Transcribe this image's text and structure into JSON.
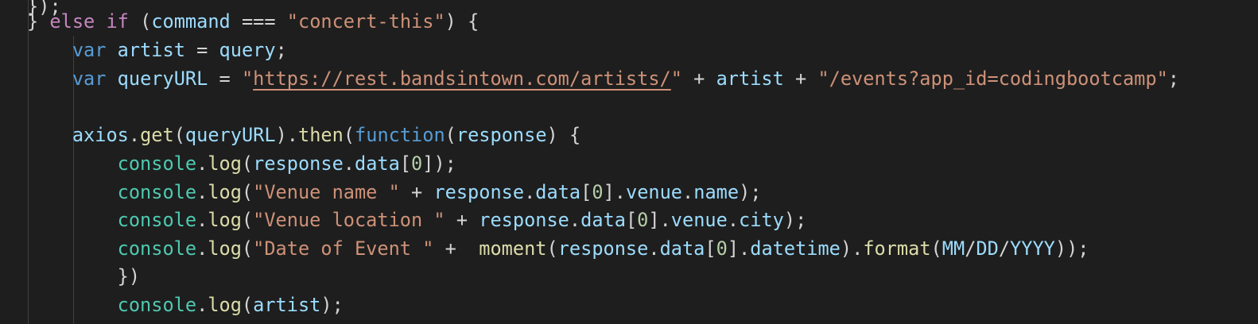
{
  "editor": {
    "language": "javascript",
    "theme_colors": {
      "background": "#1e1e1e",
      "keyword_control": "#c586c0",
      "keyword": "#569cd6",
      "variable": "#9cdcfe",
      "string": "#ce9178",
      "function": "#dcdcaa",
      "class": "#4ec9b0",
      "number": "#b5cea8",
      "default": "#d4d4d4"
    },
    "lines": [
      {
        "tokens": [
          {
            "t": "}",
            "c": "punc"
          },
          {
            "t": ")",
            "c": "punc"
          },
          {
            "t": ";",
            "c": "punc"
          }
        ]
      },
      {
        "tokens": [
          {
            "t": "} ",
            "c": "punc"
          },
          {
            "t": "else",
            "c": "kw-ctrl"
          },
          {
            "t": " ",
            "c": "punc"
          },
          {
            "t": "if",
            "c": "kw-ctrl"
          },
          {
            "t": " (",
            "c": "punc"
          },
          {
            "t": "command",
            "c": "var"
          },
          {
            "t": " === ",
            "c": "punc"
          },
          {
            "t": "\"concert-this\"",
            "c": "str"
          },
          {
            "t": ") {",
            "c": "punc"
          }
        ]
      },
      {
        "tokens": [
          {
            "t": "    ",
            "c": "punc"
          },
          {
            "t": "var",
            "c": "kw"
          },
          {
            "t": " ",
            "c": "punc"
          },
          {
            "t": "artist",
            "c": "var"
          },
          {
            "t": " = ",
            "c": "punc"
          },
          {
            "t": "query",
            "c": "var"
          },
          {
            "t": ";",
            "c": "punc"
          }
        ]
      },
      {
        "tokens": [
          {
            "t": "    ",
            "c": "punc"
          },
          {
            "t": "var",
            "c": "kw"
          },
          {
            "t": " ",
            "c": "punc"
          },
          {
            "t": "queryURL",
            "c": "var"
          },
          {
            "t": " = ",
            "c": "punc"
          },
          {
            "t": "\"",
            "c": "str"
          },
          {
            "t": "https://rest.bandsintown.com/artists/",
            "c": "link"
          },
          {
            "t": "\"",
            "c": "str"
          },
          {
            "t": " + ",
            "c": "punc"
          },
          {
            "t": "artist",
            "c": "var"
          },
          {
            "t": " + ",
            "c": "punc"
          },
          {
            "t": "\"/events?app_id=codingbootcamp\"",
            "c": "str"
          },
          {
            "t": ";",
            "c": "punc"
          }
        ]
      },
      {
        "tokens": []
      },
      {
        "tokens": [
          {
            "t": "    ",
            "c": "punc"
          },
          {
            "t": "axios",
            "c": "var"
          },
          {
            "t": ".",
            "c": "punc"
          },
          {
            "t": "get",
            "c": "fn"
          },
          {
            "t": "(",
            "c": "punc"
          },
          {
            "t": "queryURL",
            "c": "var"
          },
          {
            "t": ").",
            "c": "punc"
          },
          {
            "t": "then",
            "c": "fn"
          },
          {
            "t": "(",
            "c": "punc"
          },
          {
            "t": "function",
            "c": "kw"
          },
          {
            "t": "(",
            "c": "punc"
          },
          {
            "t": "response",
            "c": "var"
          },
          {
            "t": ") {",
            "c": "punc"
          }
        ]
      },
      {
        "tokens": [
          {
            "t": "        ",
            "c": "punc"
          },
          {
            "t": "console",
            "c": "cls"
          },
          {
            "t": ".",
            "c": "punc"
          },
          {
            "t": "log",
            "c": "fn"
          },
          {
            "t": "(",
            "c": "punc"
          },
          {
            "t": "response",
            "c": "var"
          },
          {
            "t": ".",
            "c": "punc"
          },
          {
            "t": "data",
            "c": "var"
          },
          {
            "t": "[",
            "c": "punc"
          },
          {
            "t": "0",
            "c": "num"
          },
          {
            "t": "]);",
            "c": "punc"
          }
        ]
      },
      {
        "tokens": [
          {
            "t": "        ",
            "c": "punc"
          },
          {
            "t": "console",
            "c": "cls"
          },
          {
            "t": ".",
            "c": "punc"
          },
          {
            "t": "log",
            "c": "fn"
          },
          {
            "t": "(",
            "c": "punc"
          },
          {
            "t": "\"Venue name \"",
            "c": "str"
          },
          {
            "t": " + ",
            "c": "punc"
          },
          {
            "t": "response",
            "c": "var"
          },
          {
            "t": ".",
            "c": "punc"
          },
          {
            "t": "data",
            "c": "var"
          },
          {
            "t": "[",
            "c": "punc"
          },
          {
            "t": "0",
            "c": "num"
          },
          {
            "t": "].",
            "c": "punc"
          },
          {
            "t": "venue",
            "c": "var"
          },
          {
            "t": ".",
            "c": "punc"
          },
          {
            "t": "name",
            "c": "var"
          },
          {
            "t": ");",
            "c": "punc"
          }
        ]
      },
      {
        "tokens": [
          {
            "t": "        ",
            "c": "punc"
          },
          {
            "t": "console",
            "c": "cls"
          },
          {
            "t": ".",
            "c": "punc"
          },
          {
            "t": "log",
            "c": "fn"
          },
          {
            "t": "(",
            "c": "punc"
          },
          {
            "t": "\"Venue location \"",
            "c": "str"
          },
          {
            "t": " + ",
            "c": "punc"
          },
          {
            "t": "response",
            "c": "var"
          },
          {
            "t": ".",
            "c": "punc"
          },
          {
            "t": "data",
            "c": "var"
          },
          {
            "t": "[",
            "c": "punc"
          },
          {
            "t": "0",
            "c": "num"
          },
          {
            "t": "].",
            "c": "punc"
          },
          {
            "t": "venue",
            "c": "var"
          },
          {
            "t": ".",
            "c": "punc"
          },
          {
            "t": "city",
            "c": "var"
          },
          {
            "t": ");",
            "c": "punc"
          }
        ]
      },
      {
        "tokens": [
          {
            "t": "        ",
            "c": "punc"
          },
          {
            "t": "console",
            "c": "cls"
          },
          {
            "t": ".",
            "c": "punc"
          },
          {
            "t": "log",
            "c": "fn"
          },
          {
            "t": "(",
            "c": "punc"
          },
          {
            "t": "\"Date of Event \"",
            "c": "str"
          },
          {
            "t": " +  ",
            "c": "punc"
          },
          {
            "t": "moment",
            "c": "fn"
          },
          {
            "t": "(",
            "c": "punc"
          },
          {
            "t": "response",
            "c": "var"
          },
          {
            "t": ".",
            "c": "punc"
          },
          {
            "t": "data",
            "c": "var"
          },
          {
            "t": "[",
            "c": "punc"
          },
          {
            "t": "0",
            "c": "num"
          },
          {
            "t": "].",
            "c": "punc"
          },
          {
            "t": "datetime",
            "c": "var"
          },
          {
            "t": ").",
            "c": "punc"
          },
          {
            "t": "format",
            "c": "fn"
          },
          {
            "t": "(",
            "c": "punc"
          },
          {
            "t": "MM",
            "c": "var"
          },
          {
            "t": "/",
            "c": "punc"
          },
          {
            "t": "DD",
            "c": "var"
          },
          {
            "t": "/",
            "c": "punc"
          },
          {
            "t": "YYYY",
            "c": "var"
          },
          {
            "t": "));",
            "c": "punc"
          }
        ]
      },
      {
        "tokens": [
          {
            "t": "        ",
            "c": "punc"
          },
          {
            "t": "})",
            "c": "punc"
          }
        ]
      },
      {
        "tokens": [
          {
            "t": "        ",
            "c": "punc"
          },
          {
            "t": "console",
            "c": "cls"
          },
          {
            "t": ".",
            "c": "punc"
          },
          {
            "t": "log",
            "c": "fn"
          },
          {
            "t": "(",
            "c": "punc"
          },
          {
            "t": "artist",
            "c": "var"
          },
          {
            "t": ");",
            "c": "punc"
          }
        ]
      }
    ]
  }
}
